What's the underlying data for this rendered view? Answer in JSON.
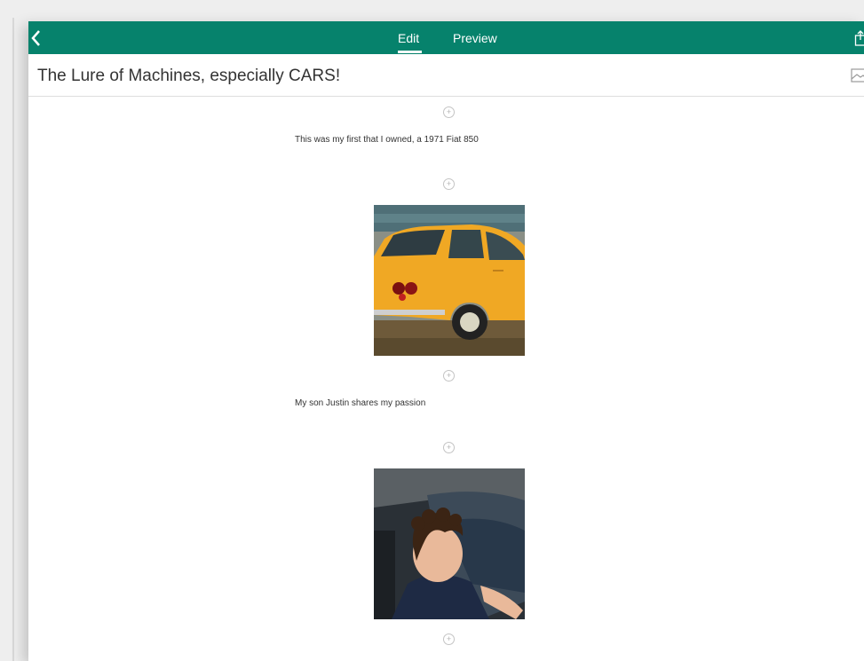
{
  "header": {
    "tabs": [
      {
        "label": "Edit"
      },
      {
        "label": "Preview"
      }
    ]
  },
  "document": {
    "title": "The Lure of Machines, especially CARS!",
    "blocks": [
      {
        "type": "text",
        "text": "This was my first that I owned, a 1971 Fiat 850"
      },
      {
        "type": "image"
      },
      {
        "type": "text",
        "text": "My son Justin shares my passion"
      },
      {
        "type": "image"
      }
    ]
  },
  "icons": {
    "back": "chevron-left-icon",
    "share": "share-icon",
    "image": "image-icon",
    "add": "plus-circle-icon"
  },
  "colors": {
    "topbar": "#06826c"
  }
}
